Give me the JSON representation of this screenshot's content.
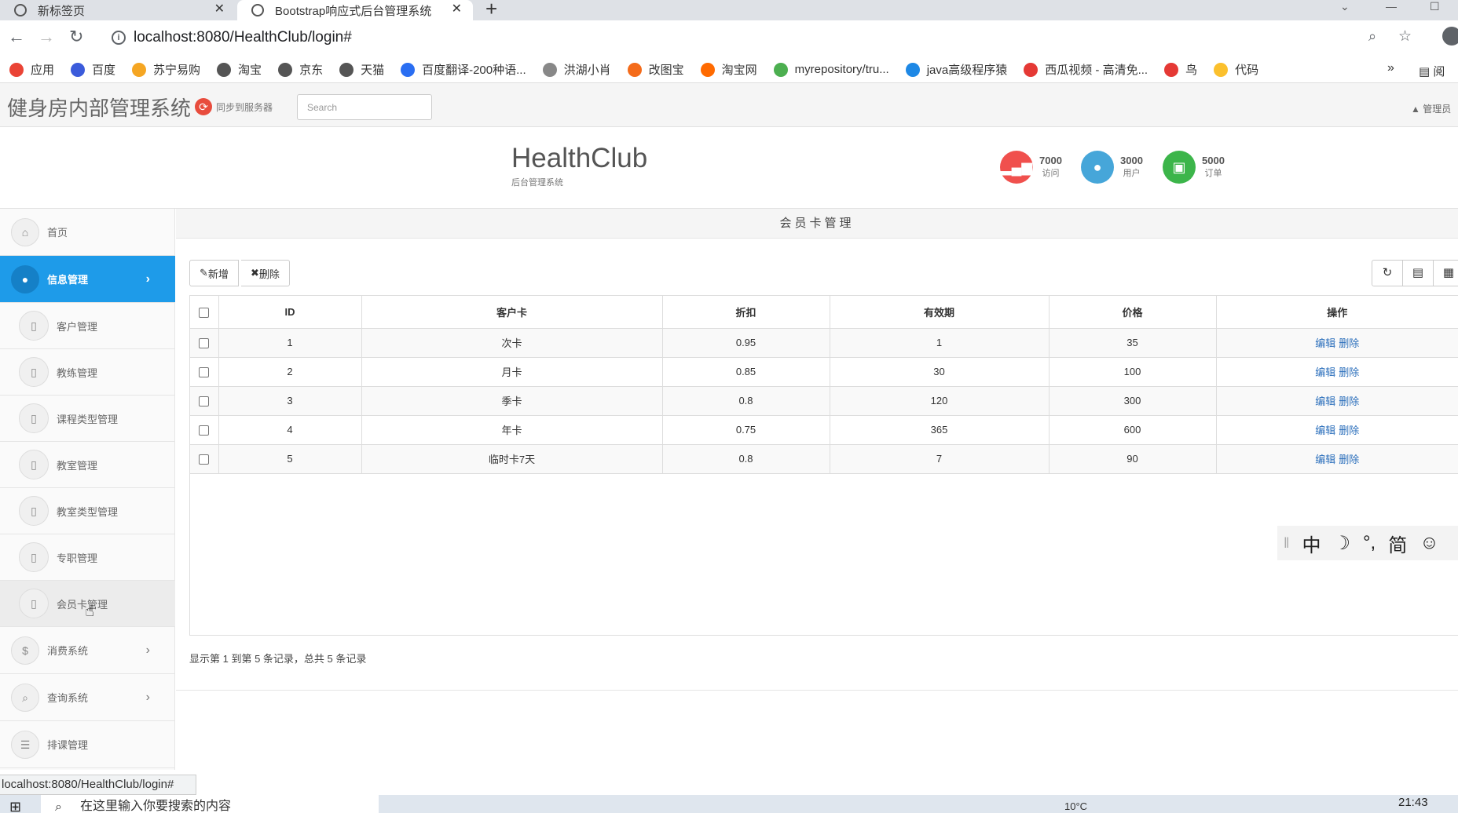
{
  "browser": {
    "tabs": [
      {
        "label": "新标签页"
      },
      {
        "label": "Bootstrap响应式后台管理系统"
      }
    ],
    "url": "localhost:8080/HealthClub/login#",
    "status_url": "localhost:8080/HealthClub/login#",
    "bookmarks": [
      {
        "label": "应用",
        "color": "#ea4335"
      },
      {
        "label": "百度",
        "color": "#3b5bdb"
      },
      {
        "label": "苏宁易购",
        "color": "#f5a623"
      },
      {
        "label": "淘宝",
        "color": "#555555"
      },
      {
        "label": "京东",
        "color": "#555555"
      },
      {
        "label": "天猫",
        "color": "#555555"
      },
      {
        "label": "百度翻译-200种语...",
        "color": "#2a6ef2"
      },
      {
        "label": "洪湖小肖",
        "color": "#888888"
      },
      {
        "label": "改图宝",
        "color": "#f46b1a"
      },
      {
        "label": "淘宝网",
        "color": "#ff6a00"
      },
      {
        "label": "myrepository/tru...",
        "color": "#4caf50"
      },
      {
        "label": "java高级程序猿",
        "color": "#1e88e5"
      },
      {
        "label": "西瓜视频 - 高清免...",
        "color": "#e53935"
      },
      {
        "label": "鸟",
        "color": "#e53935"
      },
      {
        "label": "代码",
        "color": "#fbc02d"
      }
    ],
    "bookmarks_more": "»",
    "reading_list": "阅"
  },
  "app": {
    "brand": "健身房内部管理系统",
    "sync_label": "同步到服务器",
    "search_placeholder": "Search",
    "admin_label": "管理员"
  },
  "banner": {
    "title": "HealthClub",
    "subtitle": "后台管理系统",
    "stats": [
      {
        "value": "7000",
        "label": "访问",
        "color": "#f0504d",
        "icon": "signal-icon"
      },
      {
        "value": "3000",
        "label": "用户",
        "color": "#46a6d9",
        "icon": "user-icon"
      },
      {
        "value": "5000",
        "label": "订单",
        "color": "#3cb54a",
        "icon": "money-icon"
      }
    ]
  },
  "sidebar": {
    "items": [
      {
        "label": "首页",
        "icon": "home-icon"
      },
      {
        "label": "信息管理",
        "icon": "user-icon",
        "active": true
      },
      {
        "label": "客户管理"
      },
      {
        "label": "教练管理"
      },
      {
        "label": "课程类型管理"
      },
      {
        "label": "教室管理"
      },
      {
        "label": "教室类型管理"
      },
      {
        "label": "专职管理"
      },
      {
        "label": "会员卡管理"
      },
      {
        "label": "消费系统",
        "icon": "dollar-icon"
      },
      {
        "label": "查询系统",
        "icon": "search-icon"
      },
      {
        "label": "排课管理",
        "icon": "list-icon"
      }
    ]
  },
  "main": {
    "panel_title": "会员卡管理",
    "toolbar": {
      "add_label": "新增",
      "delete_label": "删除"
    },
    "table": {
      "columns": [
        "ID",
        "客户卡",
        "折扣",
        "有效期",
        "价格",
        "操作"
      ],
      "rows": [
        {
          "id": "1",
          "card": "次卡",
          "discount": "0.95",
          "validity": "1",
          "price": "35"
        },
        {
          "id": "2",
          "card": "月卡",
          "discount": "0.85",
          "validity": "30",
          "price": "100"
        },
        {
          "id": "3",
          "card": "季卡",
          "discount": "0.8",
          "validity": "120",
          "price": "300"
        },
        {
          "id": "4",
          "card": "年卡",
          "discount": "0.75",
          "validity": "365",
          "price": "600"
        },
        {
          "id": "5",
          "card": "临时卡7天",
          "discount": "0.8",
          "validity": "7",
          "price": "90"
        }
      ],
      "edit_label": "编辑",
      "delete_label": "删除"
    },
    "pagination_note": "显示第 1 到第 5 条记录，总共 5 条记录"
  },
  "ime": {
    "items": [
      "中",
      "☽",
      "°,",
      "简",
      "☺"
    ]
  },
  "taskbar": {
    "search_placeholder": "在这里输入你要搜索的内容",
    "temperature": "10°C",
    "time": "21:43"
  }
}
